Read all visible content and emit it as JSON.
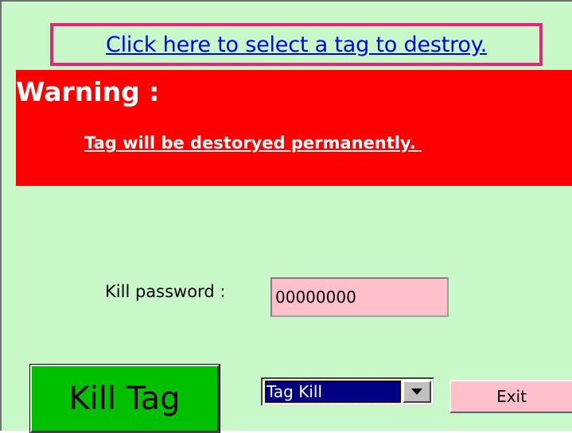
{
  "select_tag": {
    "link_label": "Click here to select a tag to destroy."
  },
  "warning": {
    "title": "Warning :",
    "message": "Tag will be destoryed permanently. "
  },
  "password": {
    "label": "Kill password :",
    "value": "00000000"
  },
  "actions": {
    "kill_label": "Kill Tag",
    "mode_selected": "Tag Kill",
    "exit_label": "Exit"
  },
  "colors": {
    "background": "#c8f8c8",
    "warning_bg": "#ff0000",
    "highlight_border": "#e8247a",
    "kill_button": "#00c000",
    "input_bg": "#ffc0cc",
    "link": "#0000ee"
  },
  "icons": {
    "dropdown": "chevron-down-icon"
  }
}
